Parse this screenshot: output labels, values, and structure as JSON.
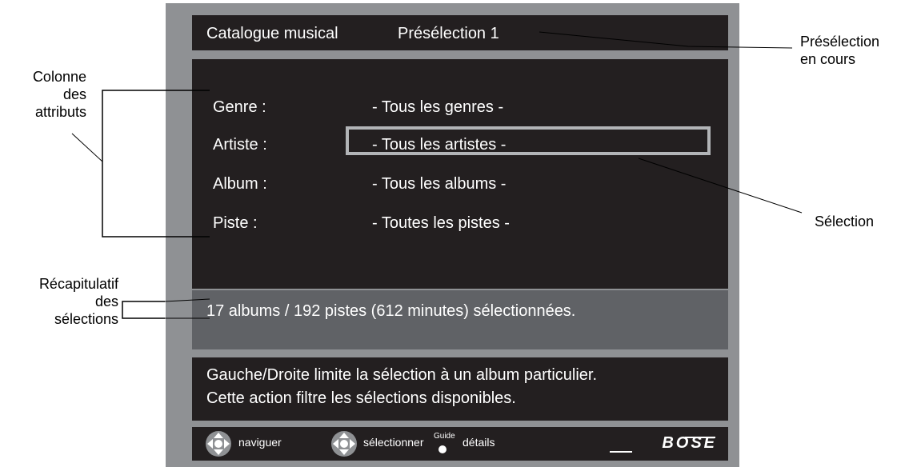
{
  "screen": {
    "header": {
      "section": "Catalogue musical",
      "preset": "Présélection 1"
    },
    "rows": [
      {
        "label": "Genre :",
        "value": "- Tous les genres -"
      },
      {
        "label": "Artiste :",
        "value": "- Tous les artistes -"
      },
      {
        "label": "Album :",
        "value": "- Tous les albums -"
      },
      {
        "label": "Piste :",
        "value": "- Toutes les pistes -"
      }
    ],
    "summary": "17 albums / 192 pistes (612 minutes) sélectionnées.",
    "help": {
      "line1": "Gauche/Droite limite la sélection à un album particulier.",
      "line2": "Cette action filtre les sélections disponibles."
    },
    "footer": {
      "navigate": "naviguer",
      "select": "sélectionner",
      "guide": "Guide",
      "details": "détails",
      "brand": "BOSE"
    }
  },
  "annotations": {
    "preset_line1": "Présélection",
    "preset_line2": "en cours",
    "attr_line1": "Colonne",
    "attr_line2": "des",
    "attr_line3": "attributs",
    "selection": "Sélection",
    "summary_line1": "Récapitulatif",
    "summary_line2": "des",
    "summary_line3": "sélections"
  },
  "colors": {
    "bezel": "#8f9194",
    "panel": "#231f20",
    "summary_band": "#606266",
    "highlight": "#b2b4b7"
  }
}
